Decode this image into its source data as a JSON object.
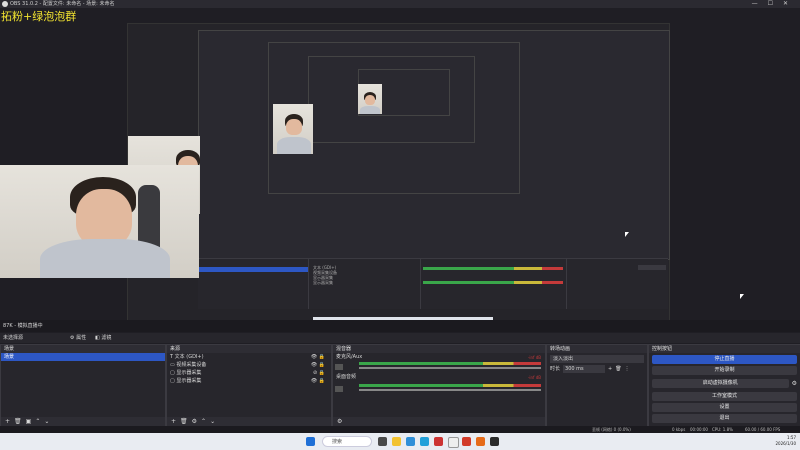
{
  "titlebar": {
    "title": "OBS 31.0.2 - 配置文件: 未命名 - 场景: 未命名",
    "minimize": "—",
    "maximize": "☐",
    "close": "✕"
  },
  "overlay": {
    "text": "拓粉+绿泡泡群"
  },
  "statusbar_top": {
    "left": "87K - 模拟直播中"
  },
  "modebar": {
    "left": "未选择源",
    "properties": "属性",
    "filters": "滤镜"
  },
  "scenes": {
    "title": "场景",
    "items": [
      "场景"
    ]
  },
  "sources": {
    "title": "来源",
    "items": [
      {
        "label": "文本 (GDI+)",
        "icon": "text-icon"
      },
      {
        "label": "视频采集设备",
        "icon": "camera-icon"
      },
      {
        "label": "显示器采集",
        "icon": "monitor-icon"
      },
      {
        "label": "显示器采集",
        "icon": "monitor-icon"
      }
    ]
  },
  "mixer": {
    "title": "混音器",
    "channels": [
      {
        "name": "麦克风/Aux",
        "db": "-inf dB"
      },
      {
        "name": "桌面音频",
        "db": "-inf dB"
      }
    ]
  },
  "transitions": {
    "title": "转场动画",
    "type": "淡入淡出",
    "duration_label": "时长",
    "duration": "300 ms"
  },
  "controls": {
    "title": "控制按钮",
    "buttons": [
      "停止直播",
      "开始录制",
      "启动虚拟摄像机",
      "工作室模式",
      "设置",
      "退出"
    ]
  },
  "statusbar_bottom": {
    "dropped": "丢帧 (网络) 0 (0.0%)",
    "cpu": "CPU: 1.8%",
    "fps": "60.00 / 60.00 FPS",
    "stream_time": "00:00:00",
    "rec_time": "00:00:00",
    "bitrate": "0 kbps"
  },
  "taskbar": {
    "search": "搜索",
    "time": "1:57",
    "date": "2026/1/30"
  },
  "colors": {
    "accent": "#2d57c4",
    "meter_green": "#3aa64a",
    "meter_yellow": "#c9b83a",
    "meter_red": "#c43a3a",
    "overlay_text": "#f2e330"
  }
}
